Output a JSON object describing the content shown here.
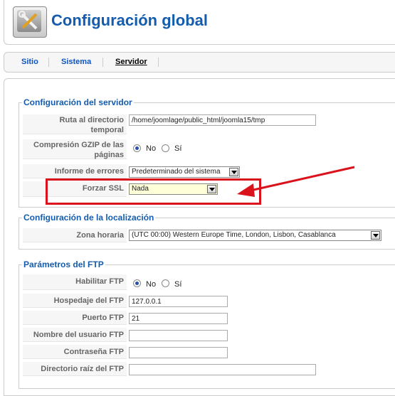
{
  "header": {
    "title": "Configuración global",
    "icon": "tools-icon"
  },
  "tabs": [
    {
      "label": "Sitio",
      "active": false
    },
    {
      "label": "Sistema",
      "active": false
    },
    {
      "label": "Servidor",
      "active": true
    }
  ],
  "server": {
    "legend": "Configuración del servidor",
    "temp_path_label_1": "Ruta al directorio",
    "temp_path_label_2": "temporal",
    "temp_path_value": "/home/joomlage/public_html/joomla15/tmp",
    "gzip_label_1": "Compresión GZIP de las",
    "gzip_label_2": "páginas",
    "gzip_no": "No",
    "gzip_yes": "Sí",
    "gzip_selected": "No",
    "errors_label": "Informe de errores",
    "errors_value": "Predeterminado del sistema",
    "ssl_label": "Forzar SSL",
    "ssl_value": "Nada"
  },
  "locale": {
    "legend": "Configuración de la localización",
    "timezone_label": "Zona horaria",
    "timezone_value": "(UTC 00:00) Western Europe Time, London, Lisbon, Casablanca"
  },
  "ftp": {
    "legend": "Parámetros del FTP",
    "enable_label": "Habilitar FTP",
    "enable_no": "No",
    "enable_yes": "Sí",
    "enable_selected": "No",
    "host_label": "Hospedaje del FTP",
    "host_value": "127.0.0.1",
    "port_label": "Puerto FTP",
    "port_value": "21",
    "user_label": "Nombre del usuario FTP",
    "user_value": "",
    "pass_label": "Contraseña FTP",
    "pass_value": "",
    "root_label": "Directorio raíz del FTP",
    "root_value": ""
  },
  "annotation": {
    "color": "#d9121b"
  }
}
